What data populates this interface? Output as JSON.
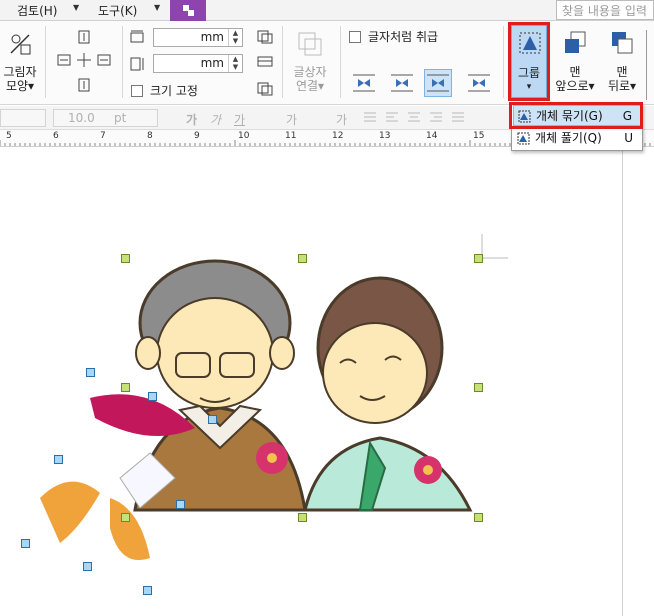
{
  "menubar": {
    "items": [
      "검토(H)",
      "도구(K)"
    ],
    "search_placeholder": "찾을 내용을 입력"
  },
  "ribbon": {
    "shape_label": "그림자\n모양▾",
    "unit1": "mm",
    "unit2": "mm",
    "fix_size": "크기 고정",
    "treat_as_char": "글자처럼 취급",
    "textbox_link": "글상자\n연결▾",
    "group": "그룹",
    "group_caret": "▾",
    "bring_front": "맨\n앞으로▾",
    "send_back": "맨\n뒤로▾"
  },
  "formatbar": {
    "size_value": "10.0",
    "unit": "pt",
    "chars": [
      "가",
      "가",
      "가",
      "가",
      "가"
    ]
  },
  "ruler": {
    "labels": [
      "5",
      "6",
      "7",
      "8",
      "9",
      "10",
      "11",
      "12",
      "13",
      "14",
      "15"
    ]
  },
  "dropdown": {
    "items": [
      {
        "label": "개체 묶기(G)",
        "key": "G"
      },
      {
        "label": "개체 풀기(Q)",
        "key": "U"
      }
    ]
  },
  "colors": {
    "accent": "#8e44ad",
    "highlight": "#e01d1d",
    "selected_fill": "#bcd8f2"
  }
}
